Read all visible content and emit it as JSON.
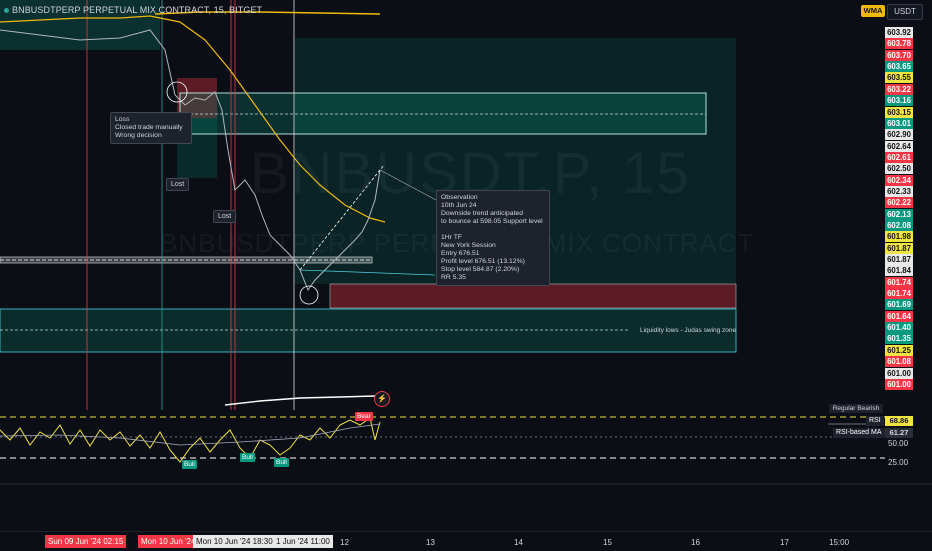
{
  "header": {
    "symbol_title": "BNBUSDTPERP PERPETUAL MIX CONTRACT, 15, BITGET",
    "wma_badge": "WMA",
    "currency": "USDT"
  },
  "watermark": {
    "line1": "BNBUSDT.P, 15",
    "line2": "BNBUSDTPERP PERPETUAL MIX CONTRACT"
  },
  "price_axis": {
    "labels": [
      {
        "text": "603.92",
        "style": "white"
      },
      {
        "text": "603.78",
        "style": "red"
      },
      {
        "text": "603.70",
        "style": "red"
      },
      {
        "text": "603.65",
        "style": "green"
      },
      {
        "text": "603.55",
        "style": "yellow"
      },
      {
        "text": "603.22",
        "style": "red"
      },
      {
        "text": "603.16",
        "style": "green"
      },
      {
        "text": "603.15",
        "style": "yellow"
      },
      {
        "text": "603.01",
        "style": "green"
      },
      {
        "text": "602.90",
        "style": "white"
      },
      {
        "text": "602.64",
        "style": "white"
      },
      {
        "text": "602.61",
        "style": "red"
      },
      {
        "text": "602.50",
        "style": "white"
      },
      {
        "text": "602.34",
        "style": "red"
      },
      {
        "text": "602.33",
        "style": "white"
      },
      {
        "text": "602.22",
        "style": "red"
      },
      {
        "text": "602.13",
        "style": "green"
      },
      {
        "text": "602.08",
        "style": "green"
      },
      {
        "text": "601.98",
        "style": "yellow"
      },
      {
        "text": "601.87",
        "style": "yellow"
      },
      {
        "text": "601.87",
        "style": "white"
      },
      {
        "text": "601.84",
        "style": "white"
      },
      {
        "text": "601.74",
        "style": "red"
      },
      {
        "text": "601.74",
        "style": "red"
      },
      {
        "text": "601.69",
        "style": "green"
      },
      {
        "text": "601.64",
        "style": "red"
      },
      {
        "text": "601.40",
        "style": "green"
      },
      {
        "text": "601.35",
        "style": "green"
      },
      {
        "text": "601.25",
        "style": "yellow"
      },
      {
        "text": "601.08",
        "style": "red"
      },
      {
        "text": "601.00",
        "style": "white"
      },
      {
        "text": "601.00",
        "style": "red"
      }
    ]
  },
  "notes": {
    "loss_note": "Loss\nClosed trade manually\nWrong decision",
    "lost_1": "Lost",
    "lost_2": "Lost",
    "observation": "Observation\n10th Jun 24\nDownside trend anticipated\nto bounce at 598.05 Support level\n\n1Hr TF\nNew York Session\nEntry 676.51\nProfit level 676.51 (13.12%)\nStop level 584.87 (2.20%)\nRR 5.35",
    "liquidity_zone": "Liquidity lows - Judas swing zone"
  },
  "rsi_pane": {
    "legend": "Regular Bearish",
    "rsi_value": "68.86",
    "rsi_name": "RSI",
    "rsi_ma_value": "61.27",
    "rsi_ma_name": "RSI-based MA",
    "tick_50": "50.00",
    "tick_25": "25.00",
    "signals": [
      "Bull",
      "Bull",
      "Bull",
      "Bear"
    ]
  },
  "time_axis": {
    "highlights": [
      {
        "text": "Sun 09 Jun '24   02:15",
        "style": "red"
      },
      {
        "text": "Mon 10 Jun '24",
        "style": "red"
      },
      {
        "text": "Mon 10 Jun '24   18:30",
        "style": "white"
      },
      {
        "text": "1 Jun '24   11:00",
        "style": "white"
      }
    ],
    "ticks": [
      "12",
      "13",
      "14",
      "15",
      "16",
      "17",
      "15:00"
    ]
  },
  "colors": {
    "bull": "#089981",
    "bear": "#f23645",
    "wma": "#f0b90b",
    "rsi_line": "#f0e442"
  }
}
